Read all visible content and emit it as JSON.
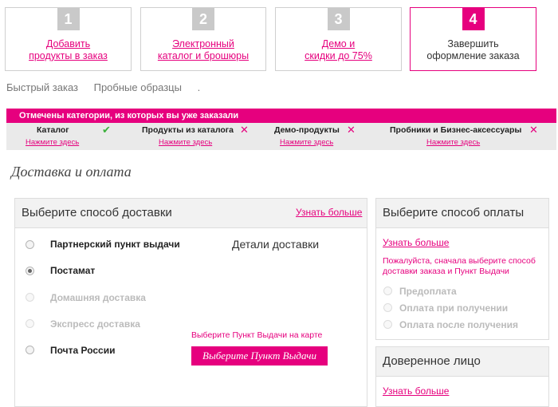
{
  "steps": [
    {
      "num": "1",
      "label": "Добавить\nпродукты в заказ"
    },
    {
      "num": "2",
      "label": "Электронный\nкаталог и брошюры"
    },
    {
      "num": "3",
      "label": "Демо и\nскидки до 75%"
    },
    {
      "num": "4",
      "label": "Завершить\nоформление заказа"
    }
  ],
  "subtabs": [
    "Быстрый заказ",
    "Пробные образцы",
    "."
  ],
  "cancelled_banner": "Отмечены категории, из которых вы уже заказали",
  "categories": [
    {
      "name": "Каталог",
      "link": "Нажмите здесь",
      "mark": "✔"
    },
    {
      "name": "Продукты из каталога",
      "link": "Нажмите здесь",
      "mark": "✕"
    },
    {
      "name": "Демо-продукты",
      "link": "Нажмите здесь",
      "mark": "✕"
    },
    {
      "name": "Пробники и Бизнес-аксессуары",
      "link": "Нажмите здесь",
      "mark": "✕"
    }
  ],
  "section_title": "Доставка и оплата",
  "delivery": {
    "title": "Выберите способ доставки",
    "learn_more": "Узнать больше",
    "details_title": "Детали доставки",
    "options": [
      {
        "label": "Партнерский пункт выдачи",
        "state": "enabled"
      },
      {
        "label": "Постамат",
        "state": "checked"
      },
      {
        "label": "Домашняя доставка",
        "state": "disabled"
      },
      {
        "label": "Экспресс доставка",
        "state": "disabled"
      },
      {
        "label": "Почта России",
        "state": "enabled"
      }
    ],
    "pickup_hint": "Выберите Пункт Выдачи на карте",
    "pickup_button": "Выберите Пункт Выдачи"
  },
  "payment": {
    "title": "Выберите способ оплаты",
    "learn_more": "Узнать больше",
    "notice": "Пожалуйста, сначала выберите способ доставки заказа и Пункт Выдачи",
    "options": [
      "Предоплата",
      "Оплата при получении",
      "Оплата после получения"
    ]
  },
  "proxy": {
    "title": "Доверенное лицо",
    "learn_more": "Узнать больше"
  },
  "colors": {
    "accent": "#e6007e",
    "check": "#3bb03b"
  }
}
